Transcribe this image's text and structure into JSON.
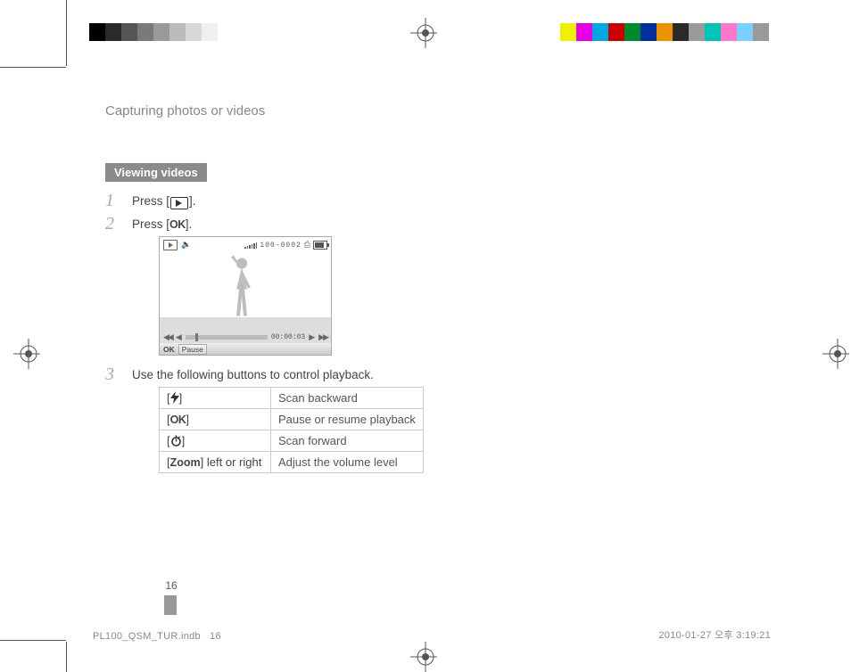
{
  "header": {
    "title": "Capturing photos or videos"
  },
  "subheading": "Viewing videos",
  "steps": {
    "s1": {
      "prefix": "Press [",
      "suffix": "]."
    },
    "s2": {
      "prefix": "Press [",
      "ok": "OK",
      "suffix": "]."
    },
    "s3": "Use the following buttons to control playback."
  },
  "video_mock": {
    "counter": "100-0002",
    "time": "00:00:03",
    "ok_label": "OK",
    "pause_label": "Pause"
  },
  "controls_table": {
    "rows": [
      {
        "key_prefix": "[",
        "key_icon": "flash",
        "key_suffix": "]",
        "extra": "",
        "desc": "Scan backward"
      },
      {
        "key_prefix": "[",
        "key_text": "OK",
        "key_suffix": "]",
        "extra": "",
        "desc": "Pause or resume playback"
      },
      {
        "key_prefix": "[",
        "key_icon": "timer",
        "key_suffix": "]",
        "extra": "",
        "desc": "Scan forward"
      },
      {
        "key_prefix": "[",
        "key_text": "Zoom",
        "key_suffix": "]",
        "extra": " left or right",
        "desc": "Adjust the volume level"
      }
    ]
  },
  "page_number": "16",
  "footer": {
    "left_file": "PL100_QSM_TUR.indb",
    "left_page": "16",
    "right": "2010-01-27   오후 3:19:21"
  }
}
